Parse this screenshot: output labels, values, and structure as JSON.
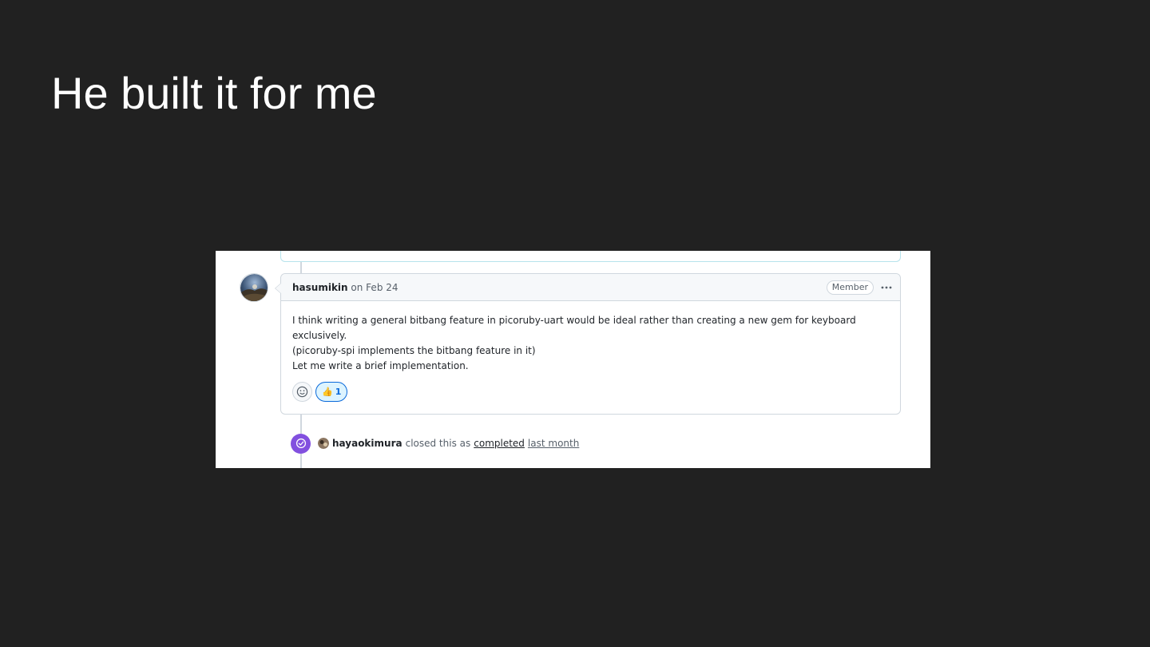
{
  "slide": {
    "title": "He built it for me"
  },
  "comment": {
    "author": "hasumikin",
    "date_text": "on Feb 24",
    "role_badge": "Member",
    "menu_icon": "kebab-horizontal-icon",
    "body": [
      "I think writing a general bitbang feature in picoruby-uart would be ideal rather than creating a new gem for keyboard",
      "exclusively.",
      "(picoruby-spi implements the bitbang feature in it)",
      "Let me write a brief implementation."
    ],
    "reactions": {
      "add_icon": "smiley-icon",
      "thumbs_up_emoji": "👍",
      "thumbs_up_count": "1"
    }
  },
  "event": {
    "icon": "check-circle-icon",
    "actor": "hayaokimura",
    "action_text": "closed this as",
    "status_link": "completed",
    "time_link": "last month"
  },
  "colors": {
    "slide_bg": "#212121",
    "closed_badge": "#8250df",
    "reaction_accent": "#0969da",
    "reaction_bg": "#ddf4ff"
  }
}
